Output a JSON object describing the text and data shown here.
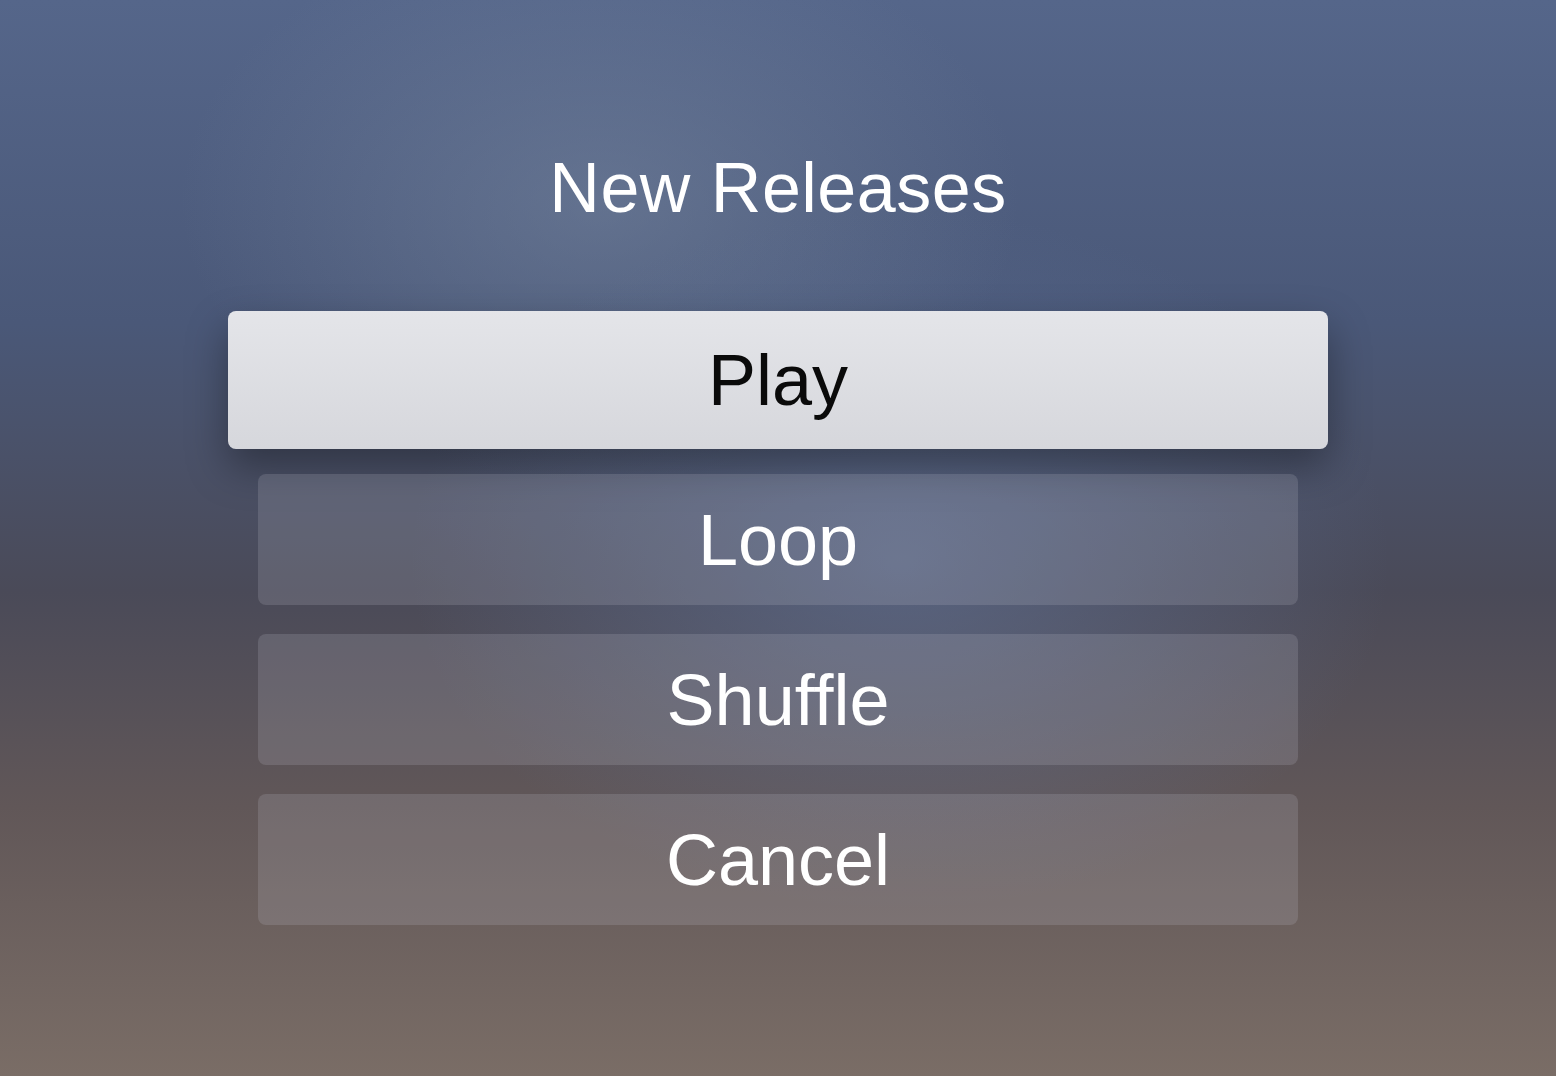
{
  "title": "New Releases",
  "options": [
    {
      "label": "Play",
      "selected": true
    },
    {
      "label": "Loop",
      "selected": false
    },
    {
      "label": "Shuffle",
      "selected": false
    },
    {
      "label": "Cancel",
      "selected": false
    }
  ]
}
